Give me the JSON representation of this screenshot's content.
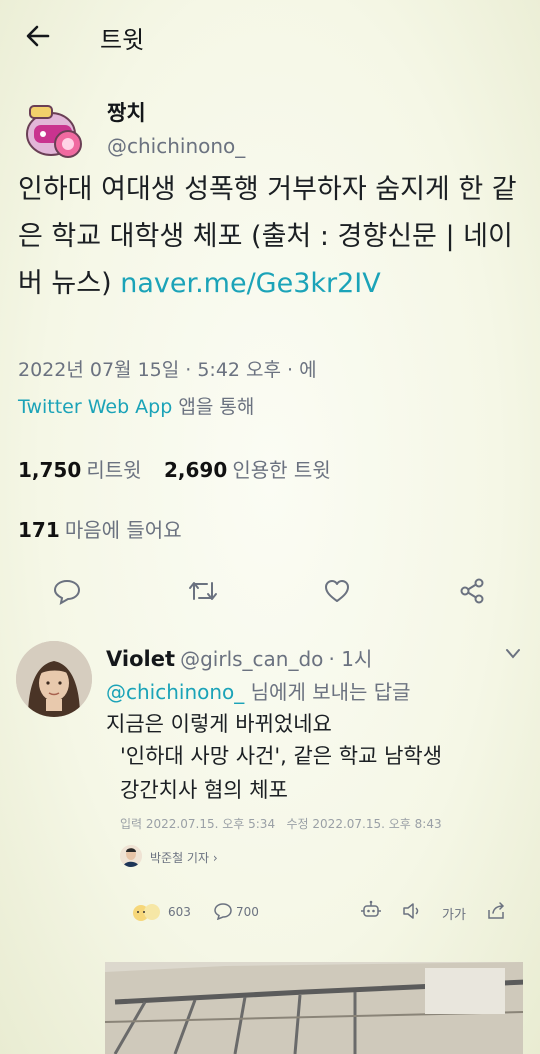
{
  "header": {
    "title": "트윗"
  },
  "tweet": {
    "author_name": "짱치",
    "author_handle": "@chichinono_",
    "text": "인하대 여대생 성폭행 거부하자 숨지게 한 같은 학교 대학생 체포 (출처 : 경향신문 | 네이버 뉴스) ",
    "link": "naver.me/Ge3kr2IV",
    "timestamp": "2022년 07월 15일 · 5:42 오후 · 에",
    "source_app": "Twitter Web App",
    "source_suffix": " 앱을 통해",
    "retweets_count": "1,750",
    "retweets_label": "리트윗",
    "quotes_count": "2,690",
    "quotes_label": "인용한 트윗",
    "likes_count": "171",
    "likes_label": "마음에 들어요"
  },
  "actions": {
    "reply_icon": "reply-icon",
    "retweet_icon": "retweet-icon",
    "like_icon": "heart-icon",
    "share_icon": "share-icon"
  },
  "reply": {
    "name": "Violet",
    "handle": "@girls_can_do",
    "time": "· 1시",
    "replying_handle": "@chichinono_",
    "replying_suffix": " 님에게 보내는 답글",
    "text": "지금은 이렇게 바뀌었네요",
    "article_headline_line1": "'인하대 사망 사건', 같은 학교 남학생",
    "article_headline_line2": "강간치사 혐의 체포",
    "article_meta": "입력 2022.07.15. 오후 5:34   수정 2022.07.15. 오후 8:43",
    "reporter": "박준철 기자 ›",
    "reaction_count": "603",
    "comment_count": "700",
    "font_label": "가가"
  },
  "colors": {
    "accent": "#1ba3b8",
    "text": "#14171a",
    "muted": "#6b7280"
  }
}
